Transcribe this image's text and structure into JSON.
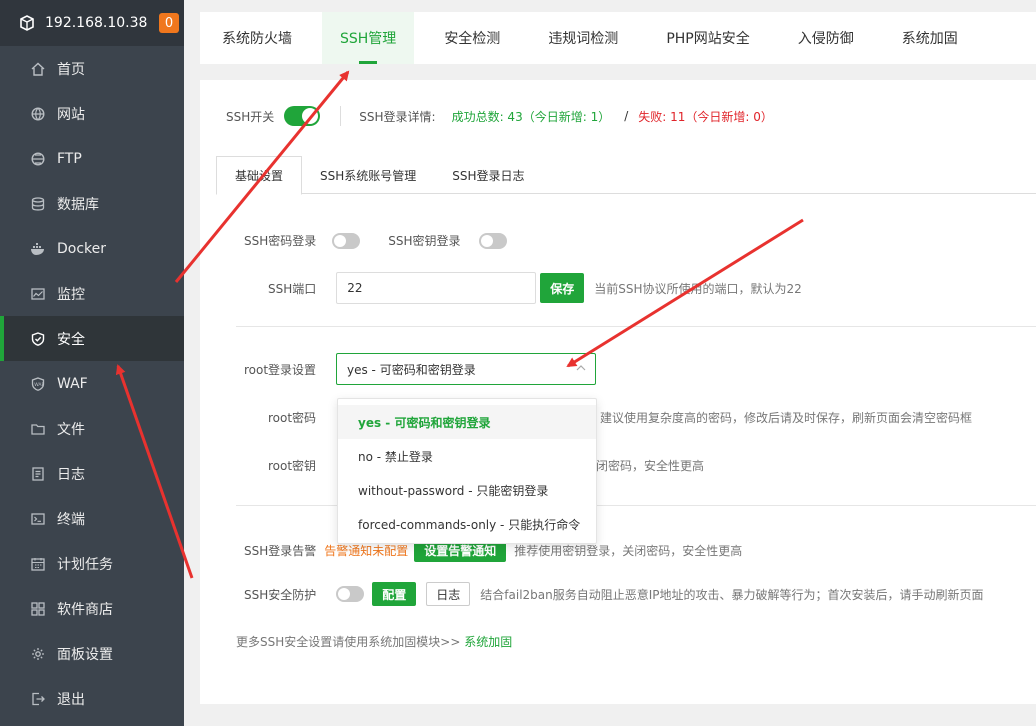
{
  "server": {
    "ip": "192.168.10.38",
    "alert_count": "0"
  },
  "sidebar": {
    "items": [
      {
        "label": "首页",
        "icon": "home-icon"
      },
      {
        "label": "网站",
        "icon": "globe-icon"
      },
      {
        "label": "FTP",
        "icon": "ftp-icon"
      },
      {
        "label": "数据库",
        "icon": "database-icon"
      },
      {
        "label": "Docker",
        "icon": "docker-icon"
      },
      {
        "label": "监控",
        "icon": "monitor-icon"
      },
      {
        "label": "安全",
        "icon": "shield-icon",
        "active": true
      },
      {
        "label": "WAF",
        "icon": "waf-icon"
      },
      {
        "label": "文件",
        "icon": "folder-icon"
      },
      {
        "label": "日志",
        "icon": "log-icon"
      },
      {
        "label": "终端",
        "icon": "terminal-icon"
      },
      {
        "label": "计划任务",
        "icon": "calendar-icon"
      },
      {
        "label": "软件商店",
        "icon": "apps-icon"
      },
      {
        "label": "面板设置",
        "icon": "gear-icon"
      },
      {
        "label": "退出",
        "icon": "logout-icon"
      }
    ]
  },
  "top_tabs": [
    {
      "label": "系统防火墙"
    },
    {
      "label": "SSH管理",
      "active": true
    },
    {
      "label": "安全检测"
    },
    {
      "label": "违规词检测"
    },
    {
      "label": "PHP网站安全"
    },
    {
      "label": "入侵防御"
    },
    {
      "label": "系统加固"
    }
  ],
  "status": {
    "ssh_switch_label": "SSH开关",
    "ssh_switch_on": true,
    "login_detail_label": "SSH登录详情:",
    "success_text": "成功总数: 43（今日新增: 1）",
    "separator": "/",
    "fail_text": "失败: 11（今日新增: 0）"
  },
  "sub_tabs": [
    {
      "label": "基础设置",
      "active": true
    },
    {
      "label": "SSH系统账号管理"
    },
    {
      "label": "SSH登录日志"
    }
  ],
  "form": {
    "password_login_label": "SSH密码登录",
    "key_login_label": "SSH密钥登录",
    "port_label": "SSH端口",
    "port_value": "22",
    "save_label": "保存",
    "port_hint": "当前SSH协议所使用的端口，默认为22",
    "root_login_label": "root登录设置",
    "root_login_value": "yes - 可密码和密钥登录",
    "root_password_label": "root密码",
    "root_password_hint": "建议使用复杂度高的密码，修改后请及时保存，刷新页面会清空密码框",
    "root_key_label": "root密钥",
    "root_key_hint": "闭密码，安全性更高",
    "alert_label": "SSH登录告警",
    "alert_status": "告警通知未配置",
    "alert_button": "设置告警通知",
    "alert_hint": "推荐使用密钥登录，关闭密码，安全性更高",
    "protect_label": "SSH安全防护",
    "config_label": "配置",
    "log_label": "日志",
    "protect_hint": "结合fail2ban服务自动阻止恶意IP地址的攻击、暴力破解等行为；首次安装后，请手动刷新页面"
  },
  "dropdown": {
    "options": [
      {
        "label": "yes - 可密码和密钥登录",
        "selected": true
      },
      {
        "label": "no - 禁止登录"
      },
      {
        "label": "without-password - 只能密钥登录"
      },
      {
        "label": "forced-commands-only - 只能执行命令"
      }
    ]
  },
  "footer": {
    "note": "更多SSH安全设置请使用系统加固模块>>",
    "link": "系统加固"
  },
  "colors": {
    "accent": "#20a53a",
    "danger": "#e0242a",
    "warning": "#f0771d",
    "sidebar": "#3c444d"
  }
}
